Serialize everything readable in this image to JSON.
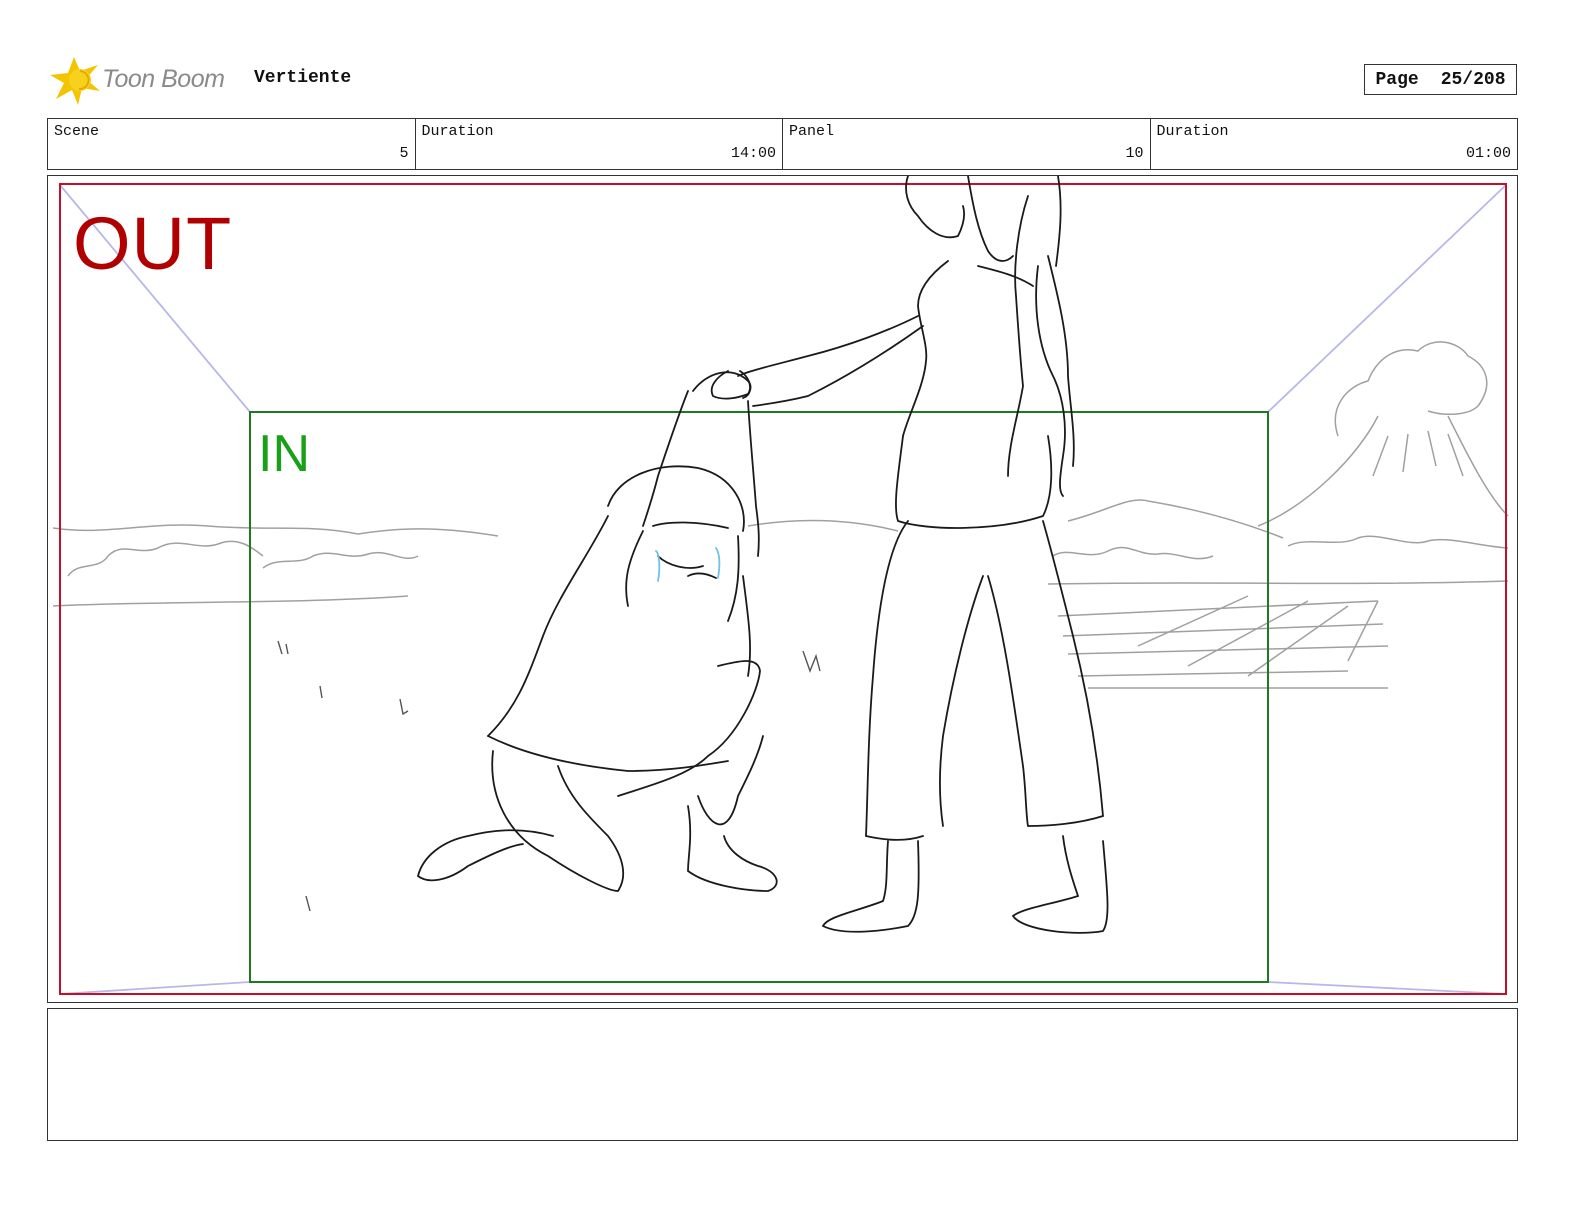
{
  "header": {
    "logo_icon": "toon-boom-star-icon",
    "logo_text": "Toon Boom",
    "project_title": "Vertiente",
    "page_label": "Page",
    "page_value": "25/208"
  },
  "info": {
    "scene_label": "Scene",
    "scene_value": "5",
    "scene_duration_label": "Duration",
    "scene_duration_value": "14:00",
    "panel_label": "Panel",
    "panel_value": "10",
    "panel_duration_label": "Duration",
    "panel_duration_value": "01:00"
  },
  "frame": {
    "out_label": "OUT",
    "in_label": "IN",
    "out_color": "#b00000",
    "in_color": "#18a018",
    "camera_guide_color": "#b8b8e8"
  },
  "notes": {
    "text": ""
  }
}
